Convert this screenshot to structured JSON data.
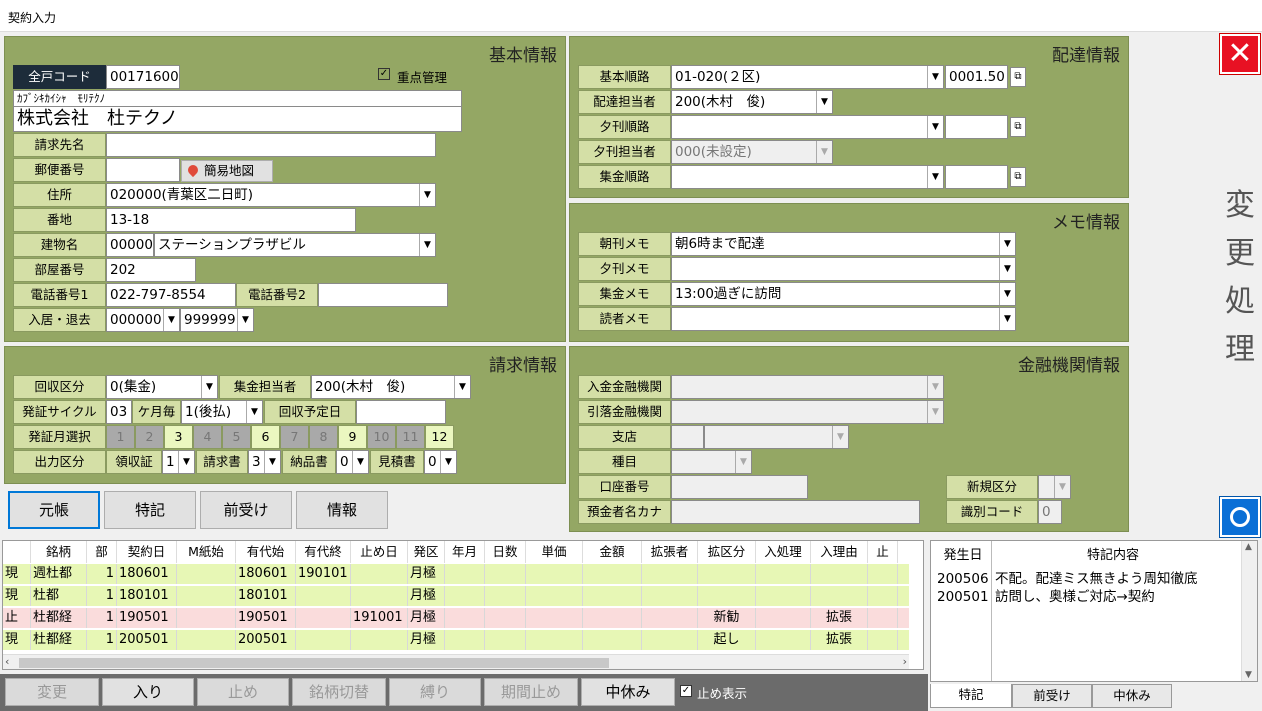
{
  "window": {
    "title": "契約入力"
  },
  "basic": {
    "title": "基本情報",
    "code_label": "全戸コード",
    "code": "00171600",
    "priority_label": "重点管理",
    "priority_checked": true,
    "kana": "ｶﾌﾞｼｷｶｲｼｬ　ﾓﾘﾃｸﾉ",
    "name": "株式会社　杜テクノ",
    "billing_name_label": "請求先名",
    "billing_name": "",
    "postal_label": "郵便番号",
    "postal": "",
    "map_button": "簡易地図",
    "address_label": "住所",
    "address": "020000(青葉区二日町)",
    "banchi_label": "番地",
    "banchi": "13-18",
    "building_label": "建物名",
    "building_code": "00000",
    "building_name": "ステーションプラザビル",
    "room_label": "部屋番号",
    "room": "202",
    "phone1_label": "電話番号1",
    "phone1": "022-797-8554",
    "phone2_label": "電話番号2",
    "phone2": "",
    "move_label": "入居・退去",
    "move_in": "000000",
    "move_out": "999999"
  },
  "delivery": {
    "title": "配達情報",
    "route_label": "基本順路",
    "route": "01-020(２区)",
    "route_num": "0001.50",
    "staff_label": "配達担当者",
    "staff": "200(木村　俊)",
    "eve_route_label": "夕刊順路",
    "eve_route": "",
    "eve_staff_label": "夕刊担当者",
    "eve_staff": "000(未設定)",
    "collect_route_label": "集金順路",
    "collect_route": ""
  },
  "memo": {
    "title": "メモ情報",
    "morning_label": "朝刊メモ",
    "morning": "朝6時まで配達",
    "evening_label": "夕刊メモ",
    "evening": "",
    "collect_label": "集金メモ",
    "collect": "13:00過ぎに訪問",
    "reader_label": "読者メモ",
    "reader": ""
  },
  "billing": {
    "title": "請求情報",
    "kaishu_label": "回収区分",
    "kaishu": "0(集金)",
    "collector_label": "集金担当者",
    "collector": "200(木村　俊)",
    "cycle_label": "発証サイクル",
    "cycle_num": "03",
    "cycle_unit": "ケ月毎",
    "cycle_type": "1(後払)",
    "schedule_label": "回収予定日",
    "schedule": "",
    "months_label": "発証月選択",
    "months": [
      {
        "n": "1",
        "on": false
      },
      {
        "n": "2",
        "on": false
      },
      {
        "n": "3",
        "on": true
      },
      {
        "n": "4",
        "on": false
      },
      {
        "n": "5",
        "on": false
      },
      {
        "n": "6",
        "on": true
      },
      {
        "n": "7",
        "on": false
      },
      {
        "n": "8",
        "on": false
      },
      {
        "n": "9",
        "on": true
      },
      {
        "n": "10",
        "on": false
      },
      {
        "n": "11",
        "on": false
      },
      {
        "n": "12",
        "on": true
      }
    ],
    "output_label": "出力区分",
    "receipt_label": "領収証",
    "receipt": "1",
    "invoice_label": "請求書",
    "invoice": "3",
    "delivery_note_label": "納品書",
    "delivery_note": "0",
    "estimate_label": "見積書",
    "estimate": "0"
  },
  "finance": {
    "title": "金融機関情報",
    "deposit_label": "入金金融機関",
    "withdraw_label": "引落金融機関",
    "branch_label": "支店",
    "type_label": "種目",
    "account_label": "口座番号",
    "holder_label": "預金者名カナ",
    "new_label": "新規区分",
    "id_label": "識別コード",
    "id_value": "0"
  },
  "buttons": {
    "ledger": "元帳",
    "special": "特記",
    "prepay": "前受け",
    "info": "情報"
  },
  "side": {
    "change": [
      "変",
      "更",
      "処",
      "理"
    ]
  },
  "grid": {
    "headers": [
      "銘柄",
      "部",
      "契約日",
      "M紙始",
      "有代始",
      "有代終",
      "止め日",
      "発区",
      "年月",
      "日数",
      "単価",
      "金額",
      "拡張者",
      "拡区分",
      "入処理",
      "入理由",
      "止"
    ],
    "rows": [
      {
        "status": "現",
        "brand": "週杜都",
        "qty": "1",
        "date": "180601",
        "m": "",
        "start": "180601",
        "end": "190101",
        "stop": "",
        "kind": "月極",
        "ext": "",
        "extkind": "",
        "inproc": "",
        "reason": "",
        "color": "#e7f7b5"
      },
      {
        "status": "現",
        "brand": "杜都",
        "qty": "1",
        "date": "180101",
        "m": "",
        "start": "180101",
        "end": "",
        "stop": "",
        "kind": "月極",
        "ext": "",
        "extkind": "",
        "inproc": "",
        "reason": "",
        "color": "#e7f7b5"
      },
      {
        "status": "止",
        "brand": "杜都経",
        "qty": "1",
        "date": "190501",
        "m": "",
        "start": "190501",
        "end": "",
        "stop": "191001",
        "kind": "月極",
        "ext": "",
        "extkind": "新勧",
        "inproc": "",
        "reason": "拡張",
        "color": "#fadcdc"
      },
      {
        "status": "現",
        "brand": "杜都経",
        "qty": "1",
        "date": "200501",
        "m": "",
        "start": "200501",
        "end": "",
        "stop": "",
        "kind": "月極",
        "ext": "",
        "extkind": "起し",
        "inproc": "",
        "reason": "拡張",
        "color": "#e7f7b5"
      }
    ]
  },
  "notes": {
    "col_date": "発生日",
    "col_content": "特記内容",
    "rows": [
      {
        "date": "200506",
        "text": "不配。配達ミス無きよう周知徹底"
      },
      {
        "date": "200501",
        "text": "訪問し、奥様ご対応→契約"
      }
    ],
    "tabs": [
      "特記",
      "前受け",
      "中休み"
    ]
  },
  "bottom": {
    "change": "変更",
    "enter": "入り",
    "stop": "止め",
    "brand_switch": "銘柄切替",
    "bind": "縛り",
    "period_stop": "期間止め",
    "pause": "中休み",
    "show_stop_label": "止め表示",
    "show_stop_checked": true
  },
  "colors": {
    "panel": "#94a764",
    "label": "#d4dfa6",
    "close": "#e81123",
    "ok": "#0a6fd6"
  }
}
